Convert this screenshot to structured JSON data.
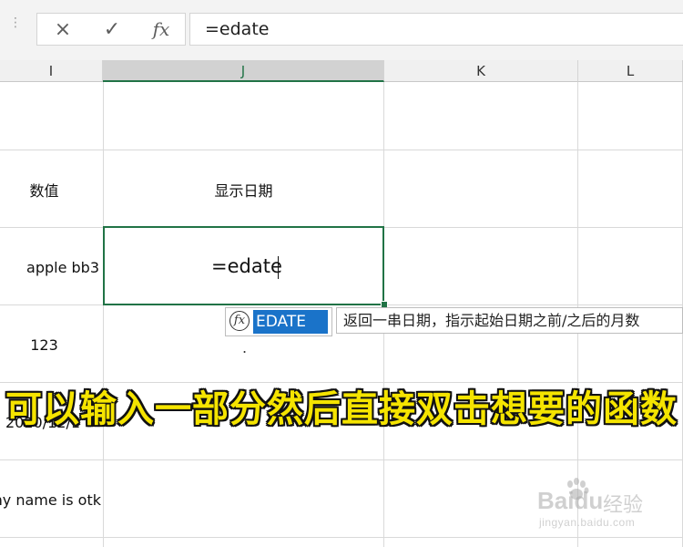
{
  "formula_bar": {
    "cancel_icon": "×",
    "enter_icon": "✓",
    "fx_label": "fx",
    "content": "=edate"
  },
  "columns": [
    {
      "label": "I",
      "active": false
    },
    {
      "label": "J",
      "active": true
    },
    {
      "label": "K",
      "active": false
    },
    {
      "label": "L",
      "active": false
    }
  ],
  "cells": {
    "i2": "数值",
    "j2": "显示日期",
    "i3": "apple bb3",
    "i4": "123",
    "i5": "2020/12/1",
    "i6": "my name is otk"
  },
  "editing": {
    "text": "=edate"
  },
  "autocomplete": {
    "icon_label": "fx",
    "item": "EDATE",
    "tooltip": "返回一串日期，指示起始日期之前/之后的月数"
  },
  "caption": "可以输入一部分然后直接双击想要的函数",
  "watermark": {
    "brand": "Bai",
    "brand_suffix": "du",
    "cn": "经验",
    "url": "jingyan.baidu.com"
  },
  "colors": {
    "accent": "#217346",
    "selection": "#1a73c9",
    "caption": "#f5e400"
  }
}
